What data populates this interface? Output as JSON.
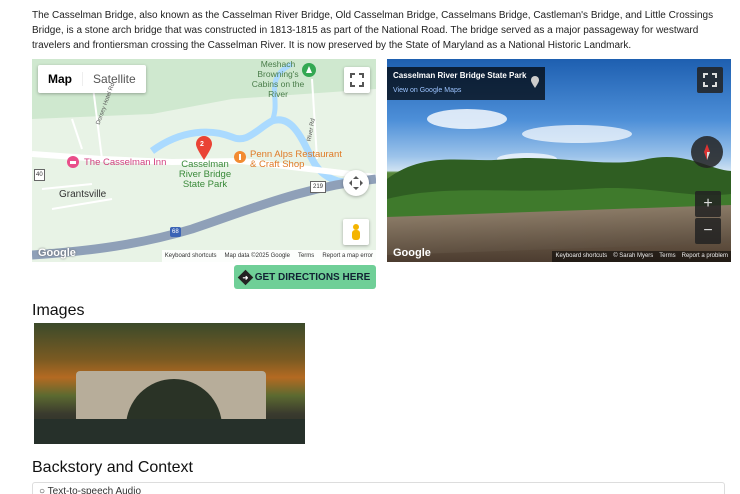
{
  "intro": "The Casselman Bridge, also known as the Casselman River Bridge, Old Casselman Bridge, Casselmans Bridge, Castleman's Bridge, and Little Crossings Bridge, is a stone arch bridge that was constructed in 1813-1815 as part of the National Road. The bridge served as a major passageway for westward travelers and frontiersman crossing the Casselman River. It is now preserved by the State of Maryland as a National Historic Landmark.",
  "map": {
    "tab_map": "Map",
    "tab_satellite": "Satellite",
    "marker_number": "2",
    "labels": {
      "cabins": "Meshach Browning's Cabins on the River",
      "casselman_inn": "The Casselman Inn",
      "bridge_park": "Casselman River Bridge State Park",
      "penn_alps": "Penn Alps Restaurant & Craft Shop",
      "grantsville": "Grantsville",
      "dorsey": "Dorsey Hotel Rd",
      "river_rd": "River Rd",
      "route_219": "219",
      "route_40": "40",
      "route_68": "68"
    },
    "footer": [
      "Keyboard shortcuts",
      "Map data ©2025 Google",
      "Terms",
      "Report a map error"
    ],
    "logo": "Google",
    "colors": {
      "water": "#aadaff",
      "highway": "#8fa0b8",
      "park": "#c8e6c9",
      "marker": "#ea4335",
      "poi": "#f28b32"
    }
  },
  "streetview": {
    "title": "Casselman River Bridge State Park",
    "link": "View on Google Maps",
    "logo": "Google",
    "footer": [
      "Keyboard shortcuts",
      "© Sarah Myers",
      "Terms",
      "Report a problem"
    ],
    "zoom_in": "+",
    "zoom_out": "−"
  },
  "directions_button": "GET DIRECTIONS HERE",
  "images_heading": "Images",
  "backstory_heading": "Backstory and Context",
  "tts_label": "Text-to-speech Audio"
}
